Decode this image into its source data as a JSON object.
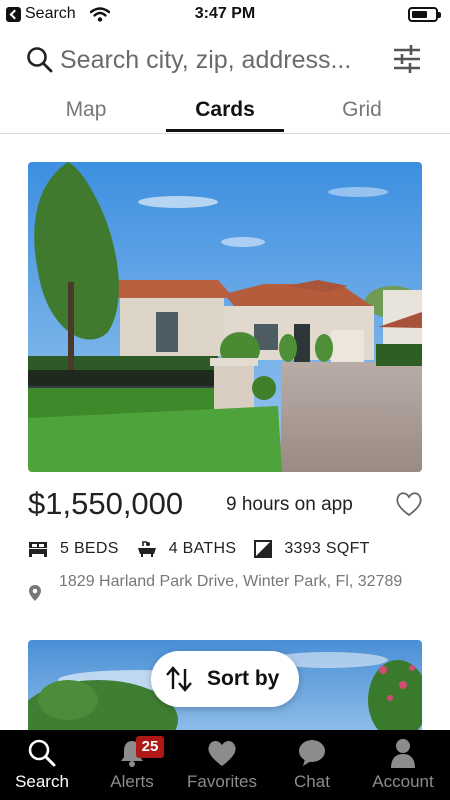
{
  "status_bar": {
    "back_label": "Search",
    "time": "3:47 PM"
  },
  "search": {
    "placeholder": "Search city, zip, address..."
  },
  "tabs": [
    {
      "label": "Map",
      "active": false
    },
    {
      "label": "Cards",
      "active": true
    },
    {
      "label": "Grid",
      "active": false
    }
  ],
  "listing": {
    "price": "$1,550,000",
    "time_on_app": "9 hours on app",
    "beds": "5 BEDS",
    "baths": "4 BATHS",
    "sqft": "3393 SQFT",
    "address": "1829 Harland Park Drive, Winter Park, Fl, 32789"
  },
  "sort_button": {
    "label": "Sort by"
  },
  "bottom_nav": [
    {
      "label": "Search",
      "icon": "search-icon",
      "active": true
    },
    {
      "label": "Alerts",
      "icon": "bell-icon",
      "badge": "25",
      "active": false
    },
    {
      "label": "Favorites",
      "icon": "heart-icon",
      "active": false
    },
    {
      "label": "Chat",
      "icon": "chat-bubble-icon",
      "active": false
    },
    {
      "label": "Account",
      "icon": "person-icon",
      "active": false
    }
  ],
  "colors": {
    "nav_background": "#000000",
    "badge": "#b01818",
    "tab_active": "#111111",
    "muted_text": "#777777"
  }
}
